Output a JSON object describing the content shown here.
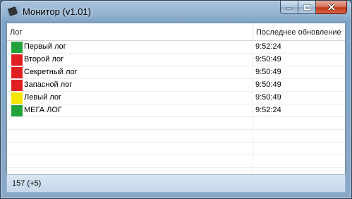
{
  "window": {
    "title": "Монитор (v1.01)",
    "close_color": "#c0391b"
  },
  "table": {
    "columns": [
      "Лог",
      "Последнее обновление"
    ],
    "rows": [
      {
        "color": "#22a33a",
        "name": "Первый лог",
        "time": "9:52:24"
      },
      {
        "color": "#e02020",
        "name": "Второй лог",
        "time": "9:50:49"
      },
      {
        "color": "#e02020",
        "name": "Секретный лог",
        "time": "9:50:49"
      },
      {
        "color": "#e02020",
        "name": "Запасной лог",
        "time": "9:50:49"
      },
      {
        "color": "#f5e400",
        "name": "Левый лог",
        "time": "9:50:49"
      },
      {
        "color": "#22a33a",
        "name": "МЕГА ЛОГ",
        "time": "9:52:24"
      }
    ],
    "empty_rows": 5
  },
  "status": {
    "text": "157 (+5)"
  }
}
